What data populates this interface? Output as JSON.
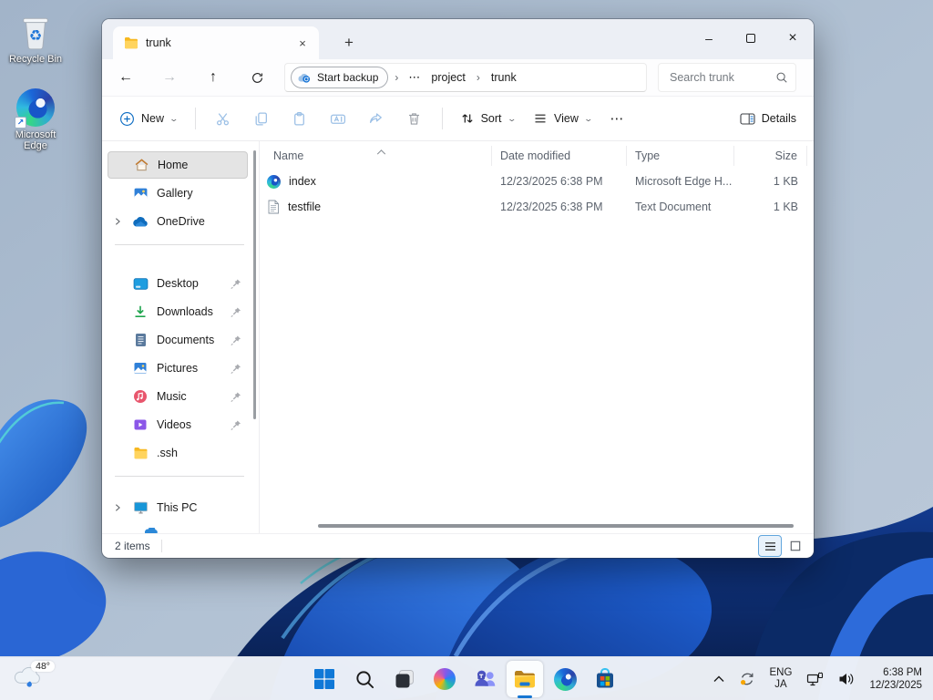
{
  "colors": {
    "accent": "#1576d2",
    "folder_yellow": "#ffd45e",
    "selection_gray": "#e4e4e4",
    "taskbar_bg": "#eff3f8"
  },
  "desktop": {
    "icons": [
      {
        "label": "Recycle Bin"
      },
      {
        "label": "Microsoft Edge"
      }
    ]
  },
  "window": {
    "tab_title": "trunk",
    "address": {
      "backup_label": "Start backup",
      "overflow": "⋯",
      "crumb1": "project",
      "crumb2": "trunk"
    },
    "search_placeholder": "Search trunk",
    "toolbar": {
      "new": "New",
      "sort": "Sort",
      "view": "View",
      "more": "⋯",
      "details": "Details"
    },
    "sidebar": {
      "items": [
        {
          "label": "Home"
        },
        {
          "label": "Gallery"
        },
        {
          "label": "OneDrive"
        },
        {
          "label": "Desktop"
        },
        {
          "label": "Downloads"
        },
        {
          "label": "Documents"
        },
        {
          "label": "Pictures"
        },
        {
          "label": "Music"
        },
        {
          "label": "Videos"
        },
        {
          "label": ".ssh"
        },
        {
          "label": "This PC"
        }
      ]
    },
    "files": {
      "columns": [
        "Name",
        "Date modified",
        "Type",
        "Size"
      ],
      "rows": [
        {
          "name": "index",
          "modified": "12/23/2025 6:38 PM",
          "type": "Microsoft Edge H...",
          "size": "1 KB"
        },
        {
          "name": "testfile",
          "modified": "12/23/2025 6:38 PM",
          "type": "Text Document",
          "size": "1 KB"
        }
      ]
    },
    "status": {
      "count": "2 items"
    }
  },
  "taskbar": {
    "weather_temp": "48°",
    "tray": {
      "lang_line1": "ENG",
      "lang_line2": "JA",
      "time": "6:38 PM",
      "date": "12/23/2025"
    }
  }
}
